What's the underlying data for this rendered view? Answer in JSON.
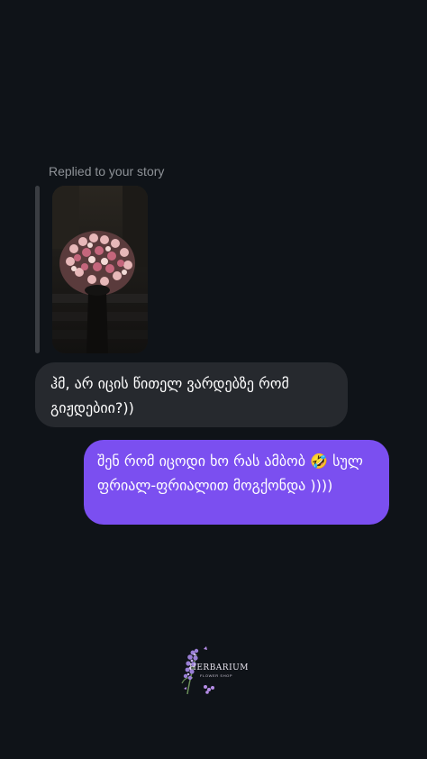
{
  "story_reply": {
    "label": "Replied to your story",
    "thumbnail_icon": "rose-bouquet-photo"
  },
  "messages": [
    {
      "direction": "received",
      "text": "ჰმ, არ იცის წითელ ვარდებზე რომ გიჟდებიი?))"
    },
    {
      "direction": "sent",
      "text": "შენ რომ იცოდი ხო რას ამბობ 🤣 სულ ფრიალ-ფრიალით მოგქონდა ))))"
    }
  ],
  "watermark": {
    "brand": "HERBARIUM",
    "tagline": "FLOWER SHOP",
    "icon": "lilac-flower-icon"
  },
  "colors": {
    "background": "#0f1318",
    "received_bubble": "#26292e",
    "sent_bubble": "#7b4ff0",
    "reply_bar": "#3a3d42"
  }
}
